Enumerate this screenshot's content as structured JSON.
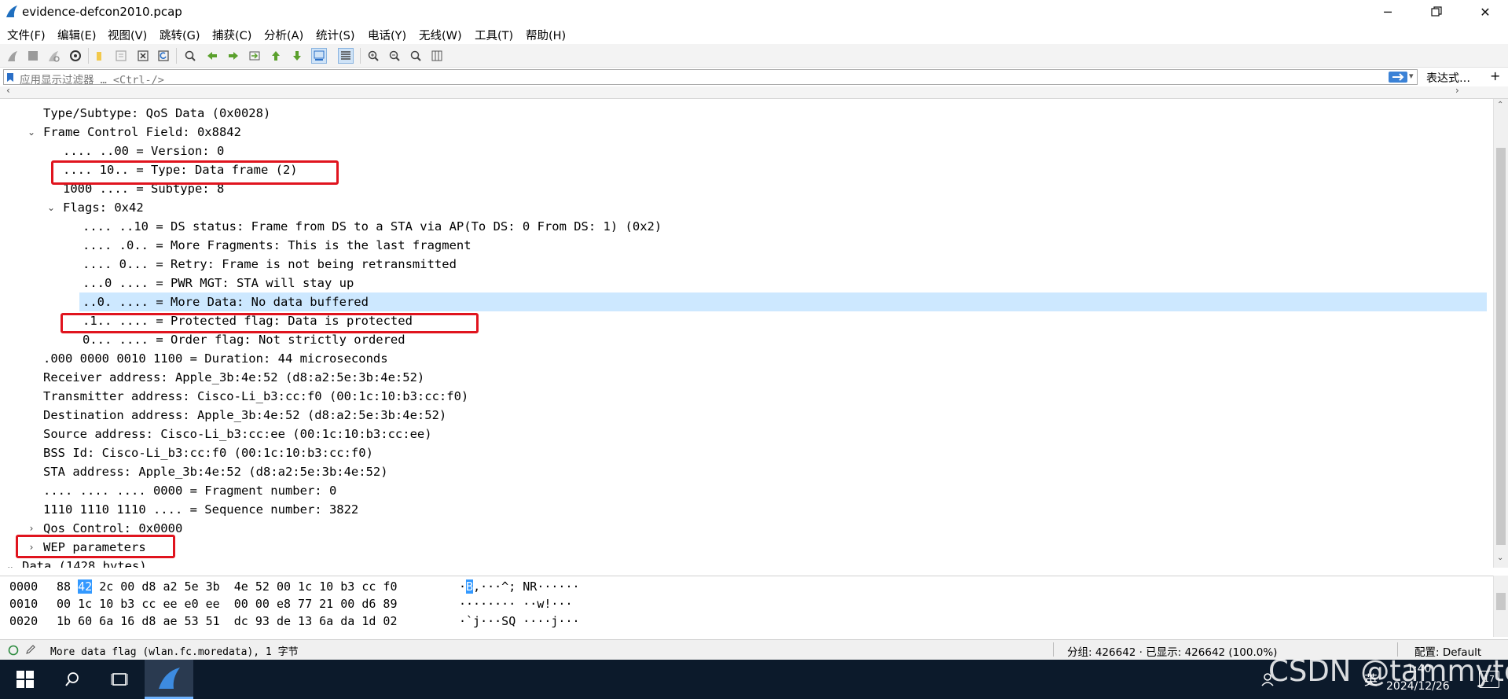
{
  "window": {
    "title": "evidence-defcon2010.pcap"
  },
  "menu": [
    "文件(F)",
    "编辑(E)",
    "视图(V)",
    "跳转(G)",
    "捕获(C)",
    "分析(A)",
    "统计(S)",
    "电话(Y)",
    "无线(W)",
    "工具(T)",
    "帮助(H)"
  ],
  "filter": {
    "placeholder": "应用显示过滤器 … <Ctrl-/>",
    "expression_label": "表达式…",
    "add_label": "+"
  },
  "details": [
    {
      "indent": 0,
      "expander": "none",
      "text": "Type/Subtype: QoS Data (0x0028)"
    },
    {
      "indent": 0,
      "expander": "open",
      "text": "Frame Control Field: 0x8842"
    },
    {
      "indent": 1,
      "expander": "none",
      "text": ".... ..00 = Version: 0"
    },
    {
      "indent": 1,
      "expander": "none",
      "text": ".... 10.. = Type: Data frame (2)"
    },
    {
      "indent": 1,
      "expander": "none",
      "text": "1000 .... = Subtype: 8"
    },
    {
      "indent": 1,
      "expander": "open",
      "text": "Flags: 0x42"
    },
    {
      "indent": 2,
      "expander": "none",
      "text": ".... ..10 = DS status: Frame from DS to a STA via AP(To DS: 0 From DS: 1) (0x2)"
    },
    {
      "indent": 2,
      "expander": "none",
      "text": ".... .0.. = More Fragments: This is the last fragment"
    },
    {
      "indent": 2,
      "expander": "none",
      "text": ".... 0... = Retry: Frame is not being retransmitted"
    },
    {
      "indent": 2,
      "expander": "none",
      "text": "...0 .... = PWR MGT: STA will stay up"
    },
    {
      "indent": 2,
      "expander": "none",
      "text": "..0. .... = More Data: No data buffered"
    },
    {
      "indent": 2,
      "expander": "none",
      "text": ".1.. .... = Protected flag: Data is protected"
    },
    {
      "indent": 2,
      "expander": "none",
      "text": "0... .... = Order flag: Not strictly ordered"
    },
    {
      "indent": 0,
      "expander": "none",
      "text": ".000 0000 0010 1100 = Duration: 44 microseconds"
    },
    {
      "indent": 0,
      "expander": "none",
      "text": "Receiver address: Apple_3b:4e:52 (d8:a2:5e:3b:4e:52)"
    },
    {
      "indent": 0,
      "expander": "none",
      "text": "Transmitter address: Cisco-Li_b3:cc:f0 (00:1c:10:b3:cc:f0)"
    },
    {
      "indent": 0,
      "expander": "none",
      "text": "Destination address: Apple_3b:4e:52 (d8:a2:5e:3b:4e:52)"
    },
    {
      "indent": 0,
      "expander": "none",
      "text": "Source address: Cisco-Li_b3:cc:ee (00:1c:10:b3:cc:ee)"
    },
    {
      "indent": 0,
      "expander": "none",
      "text": "BSS Id: Cisco-Li_b3:cc:f0 (00:1c:10:b3:cc:f0)"
    },
    {
      "indent": 0,
      "expander": "none",
      "text": "STA address: Apple_3b:4e:52 (d8:a2:5e:3b:4e:52)"
    },
    {
      "indent": 0,
      "expander": "none",
      "text": ".... .... .... 0000 = Fragment number: 0"
    },
    {
      "indent": 0,
      "expander": "none",
      "text": "1110 1110 1110 .... = Sequence number: 3822"
    },
    {
      "indent": 0,
      "expander": "closed",
      "text": "Qos Control: 0x0000"
    },
    {
      "indent": 0,
      "expander": "closed",
      "text": "WEP parameters"
    },
    {
      "indent": -1,
      "expander": "open",
      "text": "Data (1428 bytes)"
    }
  ],
  "selected_row": 10,
  "hex": [
    {
      "offset": "0000",
      "b1": "88",
      "sel": "42",
      "b2": "2c 00 d8 a2 5e 3b  4e 52 00 1c 10 b3 cc f0",
      "a1": "·",
      "asel": "B",
      "a2": ",···^; NR······"
    },
    {
      "offset": "0010",
      "b1": "00",
      "sel": "",
      "b2": "1c 10 b3 cc ee e0 ee  00 00 e8 77 21 00 d6 89",
      "a1": "········ ··w!···",
      "asel": "",
      "a2": ""
    },
    {
      "offset": "0020",
      "b1": "1b",
      "sel": "",
      "b2": "60 6a 16 d8 ae 53 51  dc 93 de 13 6a da 1d 02",
      "a1": "·`j···SQ ····j···",
      "asel": "",
      "a2": ""
    }
  ],
  "status": {
    "field_info": "More data flag (wlan.fc.moredata), 1 字节",
    "packets": "分组: 426642 · 已显示: 426642 (100.0%)",
    "profile": "配置: Default"
  },
  "taskbar": {
    "time": "1:40",
    "date": "2024/12/26",
    "ime": "英",
    "notif_count": "17",
    "watermark": "CSDN @tammytc"
  },
  "colors": {
    "selection": "#cde8ff",
    "annotation": "#e0141e",
    "hex_selection": "#3399ff",
    "taskbar": "#0c1a2b"
  }
}
